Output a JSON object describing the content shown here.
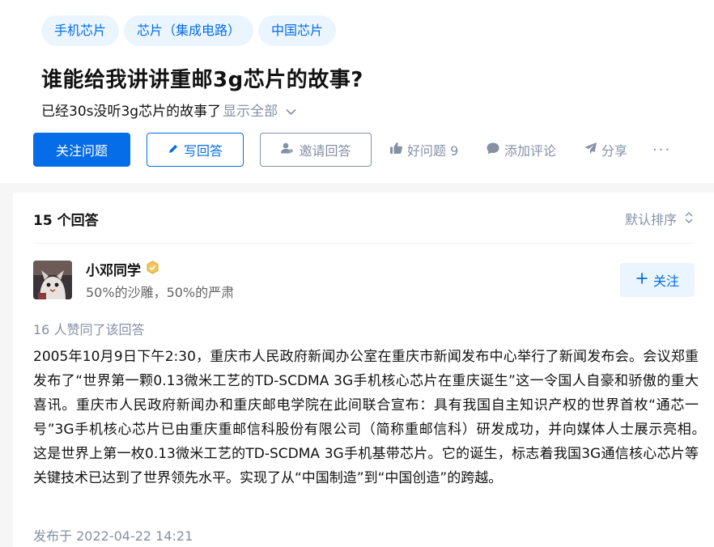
{
  "question": {
    "topics": [
      "手机芯片",
      "芯片（集成电路）",
      "中国芯片"
    ],
    "title": "谁能给我讲讲重邮3g芯片的故事?",
    "detail": "已经30s没听3g芯片的故事了",
    "show_all": "显示全部"
  },
  "actions": {
    "follow": "关注问题",
    "write": "写回答",
    "invite": "邀请回答",
    "good_question": "好问题 9",
    "comment": "添加评论",
    "share": "分享",
    "more": "···"
  },
  "answers": {
    "count": "15 个回答",
    "sort": "默认排序",
    "first": {
      "author_name": "小邓同学",
      "author_bio": "50%的沙雕，50%的严肃",
      "follow": "关注",
      "vote_info": "16 人赞同了该回答",
      "content": "2005年10月9日下午2:30，重庆市人民政府新闻办公室在重庆市新闻发布中心举行了新闻发布会。会议郑重发布了“世界第一颗0.13微米工艺的TD-SCDMA 3G手机核心芯片在重庆诞生”这一令国人自豪和骄傲的重大喜讯。重庆市人民政府新闻办和重庆邮电学院在此间联合宣布：具有我国自主知识产权的世界首枚“通芯一号”3G手机核心芯片已由重庆重邮信科股份有限公司（简称重邮信科）研发成功，并向媒体人士展示亮相。　　这是世界上第一枚0.13微米工艺的TD-SCDMA 3G手机基带芯片。它的诞生，标志着我国3G通信核心芯片等关键技术已达到了世界领先水平。实现了从“中国制造”到“中国创造”的跨越。",
      "published": "发布于 2022-04-22 14:21"
    }
  },
  "colors": {
    "accent": "#056de8",
    "accent_light": "#ebf5ff",
    "muted": "#8590a6",
    "background": "#f6f6f6"
  },
  "icons": [
    "pen-icon",
    "invite-user-icon",
    "thumb-up-icon",
    "comment-bubble-icon",
    "share-arrow-icon",
    "more-dots-icon",
    "sort-icon",
    "plus-icon",
    "badge-icon",
    "chevron-down-icon"
  ]
}
